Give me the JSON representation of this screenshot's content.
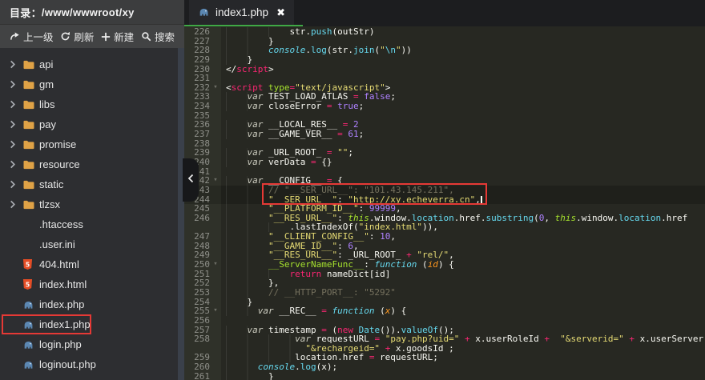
{
  "colors": {
    "accent_green": "#3fa845",
    "annotation_red": "#e53935",
    "folder_icon": "#dfa246",
    "php_icon": "#5b87b2",
    "html5_icon": "#e44d26",
    "editor_bg": "#272822",
    "string": "#e6db74",
    "keyword": "#f92672",
    "number": "#ae81ff",
    "comment": "#75715e",
    "support_function": "#66d9ef",
    "entity_green": "#a6e22e",
    "parameter_orange": "#fd971f"
  },
  "sidebar": {
    "header": {
      "label": "目录：",
      "path": "/www/wwwroot/xy"
    },
    "toolbar": [
      {
        "name": "up-button",
        "icon": "up-arrow-icon",
        "label": "上一级"
      },
      {
        "name": "refresh-button",
        "icon": "refresh-icon",
        "label": "刷新"
      },
      {
        "name": "new-button",
        "icon": "plus-icon",
        "label": "新建"
      },
      {
        "name": "search-button",
        "icon": "search-icon",
        "label": "搜索"
      }
    ],
    "tree": [
      {
        "label": "api",
        "type": "folder",
        "icon": "folder-icon"
      },
      {
        "label": "gm",
        "type": "folder",
        "icon": "folder-icon"
      },
      {
        "label": "libs",
        "type": "folder",
        "icon": "folder-icon"
      },
      {
        "label": "pay",
        "type": "folder",
        "icon": "folder-icon"
      },
      {
        "label": "promise",
        "type": "folder",
        "icon": "folder-icon"
      },
      {
        "label": "resource",
        "type": "folder",
        "icon": "folder-icon"
      },
      {
        "label": "static",
        "type": "folder",
        "icon": "folder-icon"
      },
      {
        "label": "tlzsx",
        "type": "folder",
        "icon": "folder-icon"
      },
      {
        "label": ".htaccess",
        "type": "plain",
        "icon": ""
      },
      {
        "label": ".user.ini",
        "type": "plain",
        "icon": ""
      },
      {
        "label": "404.html",
        "type": "html",
        "icon": "html5-icon"
      },
      {
        "label": "index.html",
        "type": "html",
        "icon": "html5-icon"
      },
      {
        "label": "index.php",
        "type": "php",
        "icon": "php-icon"
      },
      {
        "label": "index1.php",
        "type": "php",
        "icon": "php-icon",
        "flagged": true
      },
      {
        "label": "login.php",
        "type": "php",
        "icon": "php-icon"
      },
      {
        "label": "loginout.php",
        "type": "php",
        "icon": "php-icon"
      }
    ]
  },
  "editor": {
    "tab": {
      "label": "index1.php",
      "icon": "php-icon",
      "close_glyph": "✖"
    },
    "annotations": {
      "sidebar_flag": "index1.php",
      "code_flag_lines": "243-244",
      "active_lines": "243-244"
    },
    "lines": [
      {
        "n": "226",
        "ind": 12,
        "t": [
          [
            "pl",
            "str."
          ],
          [
            "fn",
            "push"
          ],
          [
            "pl",
            "(outStr)"
          ]
        ]
      },
      {
        "n": "227",
        "ind": 8,
        "t": [
          [
            "pl",
            "}"
          ]
        ]
      },
      {
        "n": "228",
        "ind": 8,
        "t": [
          [
            "itfn",
            "console"
          ],
          [
            "pl",
            "."
          ],
          [
            "fn",
            "log"
          ],
          [
            "pl",
            "(str."
          ],
          [
            "fn",
            "join"
          ],
          [
            "pl",
            "("
          ],
          [
            "st",
            "\""
          ],
          [
            "esc",
            "\\n"
          ],
          [
            "st",
            "\""
          ],
          [
            "pl",
            "))"
          ]
        ]
      },
      {
        "n": "229",
        "ind": 4,
        "t": [
          [
            "pl",
            "}"
          ]
        ]
      },
      {
        "n": "230",
        "ind": 0,
        "t": [
          [
            "pl",
            "</"
          ],
          [
            "tg",
            "script"
          ],
          [
            "pl",
            ">"
          ]
        ]
      },
      {
        "n": "231",
        "ind": 0,
        "t": []
      },
      {
        "n": "232",
        "ind": 0,
        "fold": true,
        "t": [
          [
            "pl",
            "<"
          ],
          [
            "tg",
            "script"
          ],
          [
            "pl",
            " "
          ],
          [
            "at",
            "type"
          ],
          [
            "kw",
            "="
          ],
          [
            "st",
            "\"text/javascript\""
          ],
          [
            "pl",
            ">"
          ]
        ]
      },
      {
        "n": "233",
        "ind": 4,
        "t": [
          [
            "va",
            "var"
          ],
          [
            "pl",
            " TEST_LOAD_ATLAS "
          ],
          [
            "kw",
            "="
          ],
          [
            "pl",
            " "
          ],
          [
            "cn",
            "false"
          ],
          [
            "pl",
            ";"
          ]
        ]
      },
      {
        "n": "234",
        "ind": 4,
        "t": [
          [
            "va",
            "var"
          ],
          [
            "pl",
            " closeError "
          ],
          [
            "kw",
            "="
          ],
          [
            "pl",
            " "
          ],
          [
            "cn",
            "true"
          ],
          [
            "pl",
            ";"
          ]
        ]
      },
      {
        "n": "235",
        "ind": 0,
        "t": []
      },
      {
        "n": "236",
        "ind": 4,
        "t": [
          [
            "va",
            "var"
          ],
          [
            "pl",
            " __LOCAL_RES__ "
          ],
          [
            "kw",
            "="
          ],
          [
            "pl",
            " "
          ],
          [
            "nu",
            "2"
          ]
        ]
      },
      {
        "n": "237",
        "ind": 4,
        "t": [
          [
            "va",
            "var"
          ],
          [
            "pl",
            " __GAME_VER__ "
          ],
          [
            "kw",
            "="
          ],
          [
            "pl",
            " "
          ],
          [
            "nu",
            "61"
          ],
          [
            "pl",
            ";"
          ]
        ]
      },
      {
        "n": "238",
        "ind": 0,
        "t": []
      },
      {
        "n": "239",
        "ind": 4,
        "t": [
          [
            "va",
            "var"
          ],
          [
            "pl",
            " _URL_ROOT_ "
          ],
          [
            "kw",
            "="
          ],
          [
            "pl",
            " "
          ],
          [
            "st",
            "\"\""
          ],
          [
            "pl",
            ";"
          ]
        ]
      },
      {
        "n": "240",
        "ind": 4,
        "t": [
          [
            "va",
            "var"
          ],
          [
            "pl",
            " verData "
          ],
          [
            "kw",
            "="
          ],
          [
            "pl",
            " {}"
          ]
        ]
      },
      {
        "n": "241",
        "ind": 0,
        "t": []
      },
      {
        "n": "242",
        "ind": 4,
        "fold": true,
        "t": [
          [
            "va",
            "var"
          ],
          [
            "pl",
            " __CONFIG__ "
          ],
          [
            "kw",
            "="
          ],
          [
            "pl",
            " {"
          ]
        ]
      },
      {
        "n": "243",
        "ind": 8,
        "hl": true,
        "t": [
          [
            "cm",
            "// \"__SER_URL__\": \"101.43.145.211\","
          ]
        ]
      },
      {
        "n": "244",
        "ind": 8,
        "hl": true,
        "cursor": true,
        "t": [
          [
            "st",
            "\"__SER_URL__\""
          ],
          [
            "pl",
            ": "
          ],
          [
            "st",
            "\"http://xy.echeverra.cn\""
          ],
          [
            "pl",
            ","
          ]
        ]
      },
      {
        "n": "245",
        "ind": 8,
        "t": [
          [
            "st",
            "\"__PLATFORM_ID__\""
          ],
          [
            "pl",
            ": "
          ],
          [
            "nu",
            "99999"
          ],
          [
            "pl",
            ","
          ]
        ]
      },
      {
        "n": "246",
        "ind": 8,
        "t": [
          [
            "st",
            "\"__RES_URL__\""
          ],
          [
            "pl",
            ": "
          ],
          [
            "th",
            "this"
          ],
          [
            "pl",
            ".window."
          ],
          [
            "fn",
            "location"
          ],
          [
            "pl",
            ".href."
          ],
          [
            "fn",
            "substring"
          ],
          [
            "pl",
            "("
          ],
          [
            "nu",
            "0"
          ],
          [
            "pl",
            ", "
          ],
          [
            "th",
            "this"
          ],
          [
            "pl",
            ".window."
          ],
          [
            "fn",
            "location"
          ],
          [
            "pl",
            ".href"
          ]
        ]
      },
      {
        "n": "",
        "ind": 12,
        "t": [
          [
            "pl",
            ".lastIndexOf("
          ],
          [
            "st",
            "\"index.html\""
          ],
          [
            "pl",
            ")),"
          ]
        ]
      },
      {
        "n": "247",
        "ind": 8,
        "t": [
          [
            "st",
            "\"__CLIENT_CONFIG__\""
          ],
          [
            "pl",
            ": "
          ],
          [
            "nu",
            "10"
          ],
          [
            "pl",
            ","
          ]
        ]
      },
      {
        "n": "248",
        "ind": 8,
        "t": [
          [
            "st",
            "\"__GAME_ID__\""
          ],
          [
            "pl",
            ": "
          ],
          [
            "nu",
            "6"
          ],
          [
            "pl",
            ","
          ]
        ]
      },
      {
        "n": "249",
        "ind": 8,
        "t": [
          [
            "st",
            "\"__RES_URL__\""
          ],
          [
            "pl",
            ": _URL_ROOT_ "
          ],
          [
            "kw",
            "+"
          ],
          [
            "pl",
            " "
          ],
          [
            "st",
            "\"rel/\""
          ],
          [
            "pl",
            ","
          ]
        ]
      },
      {
        "n": "250",
        "ind": 8,
        "fold": true,
        "t": [
          [
            "gr",
            "__ServerNameFunc__"
          ],
          [
            "pl",
            ": "
          ],
          [
            "itfn",
            "function"
          ],
          [
            "pl",
            " ("
          ],
          [
            "pa",
            "id"
          ],
          [
            "pl",
            ") {"
          ]
        ]
      },
      {
        "n": "251",
        "ind": 12,
        "t": [
          [
            "kw",
            "return"
          ],
          [
            "pl",
            " nameDict[id]"
          ]
        ]
      },
      {
        "n": "252",
        "ind": 8,
        "t": [
          [
            "pl",
            "},"
          ]
        ]
      },
      {
        "n": "253",
        "ind": 8,
        "t": [
          [
            "cm",
            "// __HTTP_PORT__: \"5292\""
          ]
        ]
      },
      {
        "n": "254",
        "ind": 4,
        "t": [
          [
            "pl",
            "}"
          ]
        ]
      },
      {
        "n": "255",
        "ind": 6,
        "fold": true,
        "t": [
          [
            "va",
            "var"
          ],
          [
            "pl",
            " __REC__ "
          ],
          [
            "kw",
            "="
          ],
          [
            "pl",
            " "
          ],
          [
            "itfn",
            "function"
          ],
          [
            "pl",
            " ("
          ],
          [
            "pa",
            "x"
          ],
          [
            "pl",
            ") {"
          ]
        ]
      },
      {
        "n": "256",
        "ind": 0,
        "t": []
      },
      {
        "n": "257",
        "ind": 4,
        "t": [
          [
            "va",
            "var"
          ],
          [
            "pl",
            " timestamp "
          ],
          [
            "kw",
            "="
          ],
          [
            "pl",
            " ("
          ],
          [
            "kw",
            "new"
          ],
          [
            "pl",
            " "
          ],
          [
            "fn",
            "Date"
          ],
          [
            "pl",
            "())."
          ],
          [
            "fn",
            "valueOf"
          ],
          [
            "pl",
            "();"
          ]
        ]
      },
      {
        "n": "258",
        "ind": 13,
        "t": [
          [
            "va",
            "var"
          ],
          [
            "pl",
            " requestURL "
          ],
          [
            "kw",
            "="
          ],
          [
            "pl",
            " "
          ],
          [
            "st",
            "\"pay.php?uid=\""
          ],
          [
            "pl",
            " "
          ],
          [
            "kw",
            "+"
          ],
          [
            "pl",
            " x.userRoleId "
          ],
          [
            "kw",
            "+"
          ],
          [
            "pl",
            "  "
          ],
          [
            "st",
            "\"&serverid=\""
          ],
          [
            "pl",
            " "
          ],
          [
            "kw",
            "+"
          ],
          [
            "pl",
            " x.userServer "
          ],
          [
            "kw",
            "+"
          ]
        ]
      },
      {
        "n": "",
        "ind": 15,
        "t": [
          [
            "st",
            "\"&rechargeid=\""
          ],
          [
            "pl",
            " "
          ],
          [
            "kw",
            "+"
          ],
          [
            "pl",
            " x.goodsId ;"
          ]
        ]
      },
      {
        "n": "259",
        "ind": 13,
        "t": [
          [
            "pl",
            "location.href "
          ],
          [
            "kw",
            "="
          ],
          [
            "pl",
            " requestURL;"
          ]
        ]
      },
      {
        "n": "260",
        "ind": 6,
        "t": [
          [
            "itfn",
            "console"
          ],
          [
            "pl",
            "."
          ],
          [
            "fn",
            "log"
          ],
          [
            "pl",
            "(x);"
          ]
        ]
      },
      {
        "n": "261",
        "ind": 8,
        "t": [
          [
            "pl",
            "}"
          ]
        ]
      }
    ]
  }
}
